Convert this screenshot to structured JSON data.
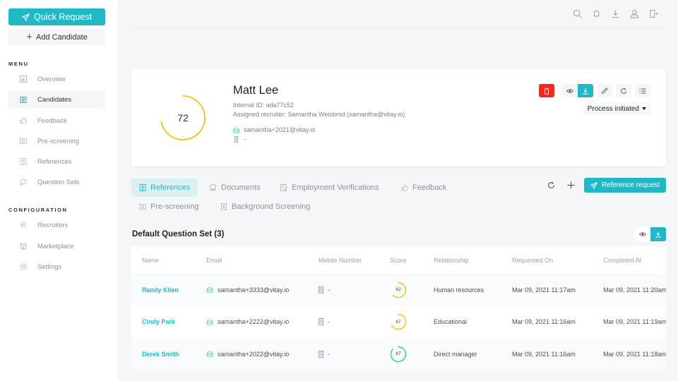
{
  "sidebar": {
    "quick_request_label": "Quick Request",
    "add_candidate_label": "Add Candidate",
    "menu_label": "MENU",
    "menu_items": [
      {
        "label": "Overview",
        "icon": "chart-icon",
        "active": false
      },
      {
        "label": "Candidates",
        "icon": "candidates-icon",
        "active": true
      },
      {
        "label": "Feedback",
        "icon": "thumbs-up-icon",
        "active": false
      },
      {
        "label": "Pre-screening",
        "icon": "prescreening-icon",
        "active": false
      },
      {
        "label": "References",
        "icon": "references-icon",
        "active": false
      },
      {
        "label": "Question Sets",
        "icon": "question-sets-icon",
        "active": false
      }
    ],
    "config_label": "CONFIGURATION",
    "config_items": [
      {
        "label": "Recruiters",
        "icon": "users-icon"
      },
      {
        "label": "Marketplace",
        "icon": "store-icon"
      },
      {
        "label": "Settings",
        "icon": "settings-icon"
      }
    ]
  },
  "topbar": {
    "icons": [
      "search-icon",
      "bell-icon",
      "download-icon",
      "user-icon",
      "logout-icon"
    ]
  },
  "candidate": {
    "name": "Matt Lee",
    "score": 72,
    "score_fraction": 0.72,
    "score_color": "#f5c211",
    "internal_id": "Internal ID: ada77c52",
    "recruiter": "Assigned recruiter: Samantha Weisbrod (samantha@vitay.io)",
    "email": "samantha+2021@vitay.io",
    "mobile": "-",
    "status": "Process initiated",
    "actions": [
      "delete",
      "view",
      "download",
      "edit",
      "refresh",
      "list"
    ]
  },
  "tabs": [
    {
      "label": "References",
      "icon": "references-icon",
      "active": true
    },
    {
      "label": "Documents",
      "icon": "documents-icon",
      "active": false
    },
    {
      "label": "Employment Verifications",
      "icon": "verification-icon",
      "active": false
    },
    {
      "label": "Feedback",
      "icon": "thumbs-up-icon",
      "active": false
    },
    {
      "label": "Pre-screening",
      "icon": "prescreening-icon",
      "active": false
    },
    {
      "label": "Background Screening",
      "icon": "background-icon",
      "active": false
    }
  ],
  "reference_request_label": "Reference request",
  "question_set": {
    "title": "Default Question Set (3)",
    "columns": [
      "Name",
      "Email",
      "Mobile Number",
      "Score",
      "Relationship",
      "Requested On",
      "Completed At"
    ],
    "rows": [
      {
        "name": "Randy Klien",
        "email": "samantha+3333@vitay.io",
        "mobile": "-",
        "score": 62,
        "score_color": "#f5c211",
        "relationship": "Human resources",
        "requested": "Mar 09, 2021 11:17am",
        "completed": "Mar 09, 2021 11:20am"
      },
      {
        "name": "Cindy Park",
        "email": "samantha+2222@vitay.io",
        "mobile": "-",
        "score": 67,
        "score_color": "#f5c211",
        "relationship": "Educational",
        "requested": "Mar 09, 2021 11:16am",
        "completed": "Mar 09, 2021 11:19am"
      },
      {
        "name": "Derek Smith",
        "email": "samantha+2022@vitay.io",
        "mobile": "-",
        "score": 87,
        "score_color": "#2ecc8f",
        "relationship": "Direct manager",
        "requested": "Mar 09, 2021 11:16am",
        "completed": "Mar 09, 2021 11:18am"
      }
    ]
  },
  "colors": {
    "accent": "#21b8c6",
    "danger": "#f5271f",
    "warning": "#f5c211",
    "success": "#2ecc8f"
  }
}
